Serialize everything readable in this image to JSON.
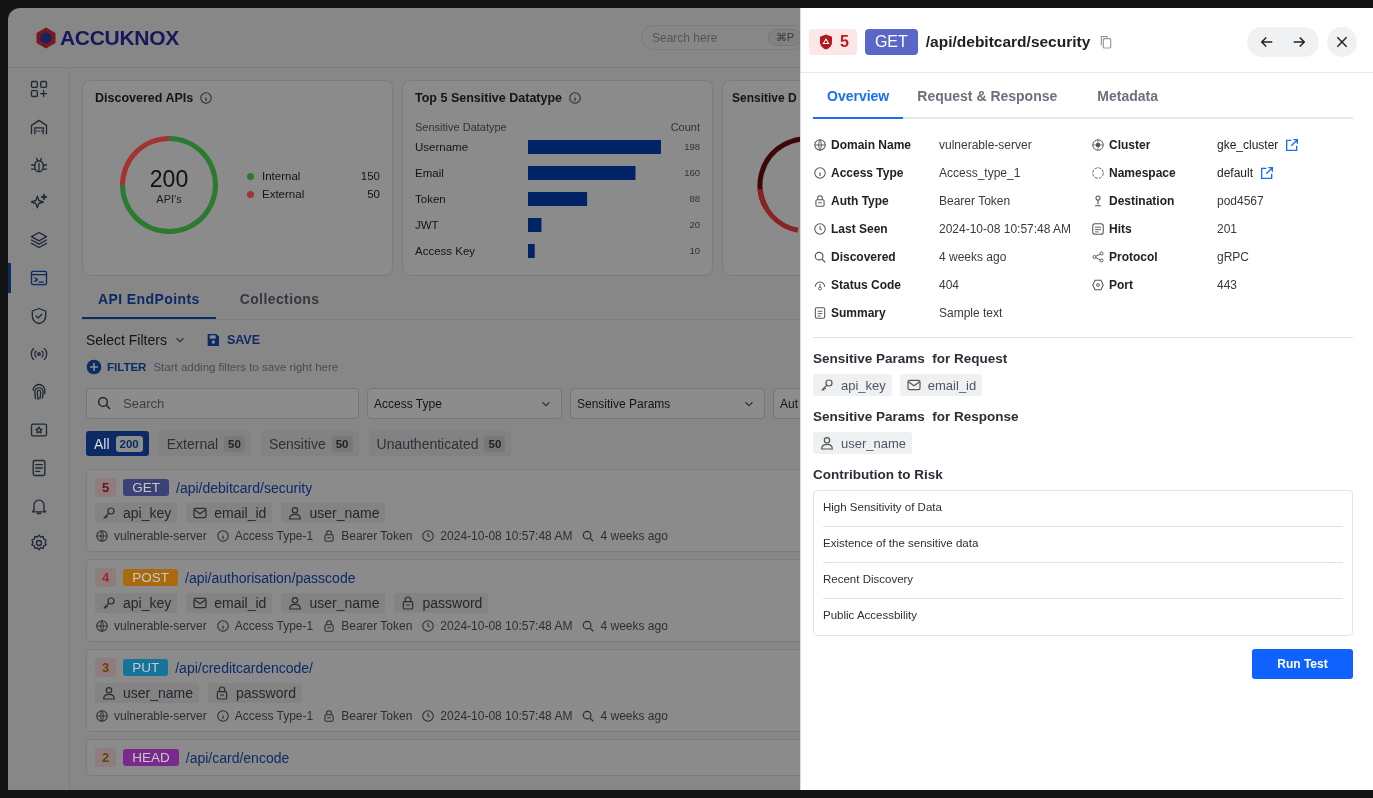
{
  "app": {
    "logo": "ACCUKNOX",
    "search": {
      "placeholder": "Search here",
      "shortcut": "⌘P"
    }
  },
  "sidebar": {
    "items": [
      {
        "selected": false
      },
      {
        "selected": false
      },
      {
        "selected": false
      },
      {
        "selected": false
      },
      {
        "selected": false
      },
      {
        "selected": true
      },
      {
        "selected": false
      },
      {
        "selected": false
      },
      {
        "selected": false
      },
      {
        "selected": false
      },
      {
        "selected": false
      },
      {
        "selected": false
      },
      {
        "selected": false
      }
    ]
  },
  "discovered_apis": {
    "title": "Discovered APIs",
    "total": "200",
    "total_label": "API's",
    "legend": [
      {
        "value": "150",
        "color": "#2a7a2f"
      },
      {
        "value": "50",
        "color": "#a33232"
      }
    ],
    "chart_data": {
      "type": "donut",
      "categories": [
        "Internal",
        "External"
      ],
      "values": [
        75,
        25
      ]
    }
  },
  "top_sensitive": {
    "title": "Top 5 Sensitive Datatype",
    "column_1": "Sensitive Datatype",
    "chart_data": {
      "type": "bar",
      "orientation": "horizontal",
      "categories": [
        "Username",
        "Email",
        "Token",
        "JWT",
        "Access Key"
      ],
      "series": [
        {
          "name": "Count",
          "color": "#002466",
          "values": [
            198,
            160,
            88,
            20,
            10
          ]
        }
      ],
      "data_labels": true
    }
  },
  "third_card": {
    "title": "Sensitive D"
  },
  "endpoint_tabs": [
    {
      "label": "API EndPoints",
      "selected": true
    },
    {
      "label": "Collections",
      "selected": false
    }
  ],
  "filters": {
    "select_label": "Select Filters",
    "save_label": "SAVE",
    "filter_label": "FILTER",
    "filter_hint": "Start adding filters to save right here",
    "search_placeholder": "Search",
    "dropdowns": [
      "Access Type",
      "Sensitive Params",
      "Aut"
    ]
  },
  "chips": [
    {
      "label": "All",
      "count": "200",
      "selected": true
    },
    {
      "label": "External",
      "count": "50",
      "selected": false
    },
    {
      "label": "Sensitive",
      "count": "50",
      "selected": false
    },
    {
      "label": "Unauthenticated",
      "count": "50",
      "selected": false
    }
  ],
  "endpoints": [
    {
      "risk": {
        "value": "5",
        "color": "#6b1010"
      },
      "method": {
        "label": "GET",
        "color": "#3a4275"
      },
      "path": "/api/debitcard/security",
      "params": [
        {
          "kind": "key",
          "label": "api_key"
        },
        {
          "kind": "mail",
          "label": "email_id"
        },
        {
          "kind": "user",
          "label": "user_name"
        }
      ],
      "meta": [
        {
          "kind": "globe",
          "text": "vulnerable-server"
        },
        {
          "kind": "info",
          "text": "Access Type-1"
        },
        {
          "kind": "lock",
          "text": "Bearer Token"
        },
        {
          "kind": "clock",
          "text": "2024-10-08 10:57:48 AM"
        },
        {
          "kind": "search",
          "text": "4 weeks ago"
        }
      ]
    },
    {
      "risk": {
        "value": "4",
        "color": "#a82424"
      },
      "method": {
        "label": "POST",
        "color": "#a8690f"
      },
      "path": "/api/authorisation/passcode",
      "params": [
        {
          "kind": "key",
          "label": "api_key"
        },
        {
          "kind": "mail",
          "label": "email_id"
        },
        {
          "kind": "user",
          "label": "user_name"
        },
        {
          "kind": "lock",
          "label": "password"
        }
      ],
      "meta": [
        {
          "kind": "globe",
          "text": "vulnerable-server"
        },
        {
          "kind": "info",
          "text": "Access Type-1"
        },
        {
          "kind": "lock",
          "text": "Bearer Token"
        },
        {
          "kind": "clock",
          "text": "2024-10-08 10:57:48 AM"
        },
        {
          "kind": "search",
          "text": "4 weeks ago"
        }
      ]
    },
    {
      "risk": {
        "value": "3",
        "color": "#6e4000"
      },
      "method": {
        "label": "PUT",
        "color": "#16739b"
      },
      "path": "/api/creditcardencode/",
      "params": [
        {
          "kind": "user",
          "label": "user_name"
        },
        {
          "kind": "lock",
          "label": "password"
        }
      ],
      "meta": [
        {
          "kind": "globe",
          "text": "vulnerable-server"
        },
        {
          "kind": "info",
          "text": "Access Type-1"
        },
        {
          "kind": "lock",
          "text": "Bearer Token"
        },
        {
          "kind": "clock",
          "text": "2024-10-08 10:57:48 AM"
        },
        {
          "kind": "search",
          "text": "4 weeks ago"
        }
      ]
    },
    {
      "risk": {
        "value": "2",
        "color": "#5c4600"
      },
      "method": {
        "label": "HEAD",
        "color": "#7a2a8c"
      },
      "path": "/api/card/encode"
    }
  ],
  "detail": {
    "risk_score": "5",
    "method": {
      "label": "GET",
      "color": "#5b67c8"
    },
    "path": "/api/debitcard/security",
    "tabs": [
      {
        "label": "Overview",
        "selected": true
      },
      {
        "label": "Request & Response",
        "selected": false
      },
      {
        "label": "Metadata",
        "selected": false
      }
    ],
    "rows": [
      {
        "left": {
          "kind": "globe",
          "label": "Domain Name",
          "value": "vulnerable-server",
          "link": false
        },
        "right": {
          "kind": "cluster",
          "label": "Cluster",
          "value": "gke_cluster",
          "link": true
        }
      },
      {
        "left": {
          "kind": "info",
          "label": "Access Type",
          "value": "Access_type_1",
          "link": false
        },
        "right": {
          "kind": "namespace",
          "label": "Namespace",
          "value": "default",
          "link": true
        }
      },
      {
        "left": {
          "kind": "lock",
          "label": "Auth Type",
          "value": "Bearer Token",
          "link": false
        },
        "right": {
          "kind": "pin",
          "label": "Destination",
          "value": "pod4567",
          "link": false
        }
      },
      {
        "left": {
          "kind": "clock",
          "label": "Last Seen",
          "value": "2024-10-08 10:57:48 AM",
          "link": false
        },
        "right": {
          "kind": "list",
          "label": "Hits",
          "value": "201",
          "link": false
        }
      },
      {
        "left": {
          "kind": "search",
          "label": "Discovered",
          "value": "4 weeks ago",
          "link": false
        },
        "right": {
          "kind": "share",
          "label": "Protocol",
          "value": "gRPC",
          "link": false
        }
      },
      {
        "left": {
          "kind": "gauge",
          "label": "Status Code",
          "value": "404",
          "link": false
        },
        "right": {
          "kind": "port",
          "label": "Port",
          "value": "443",
          "link": false
        }
      },
      {
        "left": {
          "kind": "note",
          "label": "Summary",
          "value": "Sample text",
          "link": false
        }
      }
    ],
    "request_heading": "Sensitive Params  for Request",
    "request_params": [
      {
        "kind": "key",
        "label": "api_key"
      },
      {
        "kind": "mail",
        "label": "email_id"
      }
    ],
    "response_heading": "Sensitive Params  for Response",
    "response_params": [
      {
        "kind": "user",
        "label": "user_name"
      }
    ],
    "risk_heading": "Contribution to Risk",
    "risk_items": [
      "High Sensitivity of Data",
      "Existence of the sensitive data",
      "Recent Discovery",
      "Public Accessbility"
    ],
    "run_label": "Run Test"
  }
}
